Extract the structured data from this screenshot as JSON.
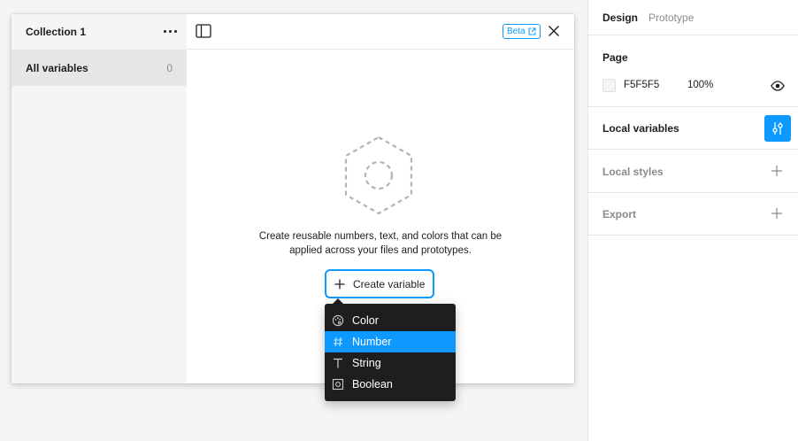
{
  "collection": {
    "title": "Collection 1",
    "all_variables_label": "All variables",
    "all_variables_count": "0"
  },
  "header": {
    "beta_label": "Beta"
  },
  "empty_state": {
    "line1": "Create reusable numbers, text, and colors that can be",
    "line2": "applied across your files and prototypes.",
    "create_label": "Create variable"
  },
  "menu": {
    "items": [
      {
        "label": "Color",
        "icon": "palette-icon"
      },
      {
        "label": "Number",
        "icon": "hash-icon",
        "active": true
      },
      {
        "label": "String",
        "icon": "text-icon"
      },
      {
        "label": "Boolean",
        "icon": "toggle-icon"
      }
    ]
  },
  "sidebar": {
    "tabs": [
      "Design",
      "Prototype"
    ],
    "page_title": "Page",
    "page_color": "F5F5F5",
    "page_zoom": "100%",
    "local_variables": "Local variables",
    "local_styles": "Local styles",
    "export": "Export"
  },
  "colors": {
    "accent": "#0d99ff",
    "menu_bg": "#1e1e1e",
    "canvas_bg": "#f5f5f5"
  }
}
